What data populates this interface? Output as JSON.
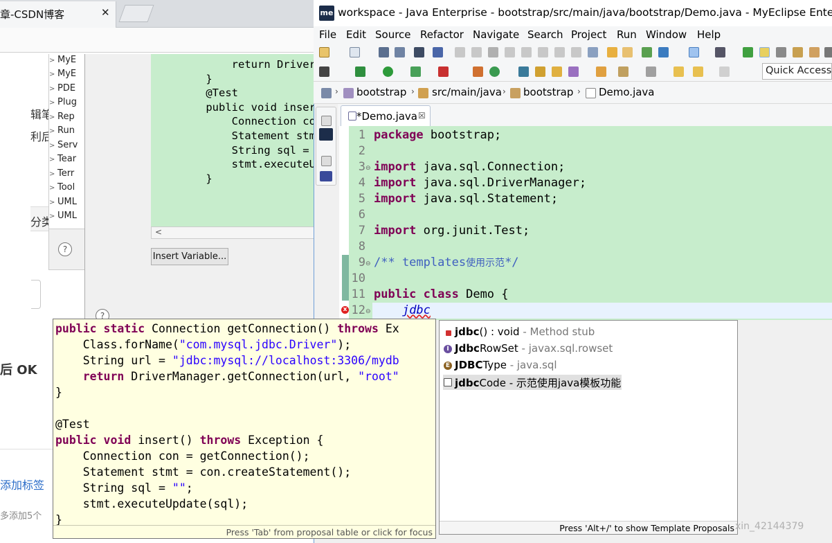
{
  "browser": {
    "tab_title": "章-CSDN博客",
    "tab_close": "✕",
    "side_fragments": [
      "辑笔",
      "利后",
      "分类",
      "后 OK",
      "添加标签",
      "多添加5个"
    ]
  },
  "preferences_dialog": {
    "tree_items": [
      "MyE",
      "MyE",
      "PDE",
      "Plug",
      "Rep",
      "Run",
      "Serv",
      "Tear",
      "Terr",
      "Tool",
      "UML",
      "UML"
    ],
    "help_symbol": "?",
    "editor_code": "        return DriverMana\n    }\n    @Test\n    public void insert()\n        Connection con =\n        Statement stmt =\n        String sql = \"\";\n        stmt.executeUpda\n    }",
    "scroll_left": "<",
    "insert_variable_button": "Insert Variable..."
  },
  "eclipse": {
    "logo": "me",
    "title": "workspace - Java Enterprise - bootstrap/src/main/java/bootstrap/Demo.java - MyEclipse Ente...",
    "menu": [
      "File",
      "Edit",
      "Source",
      "Refactor",
      "Navigate",
      "Search",
      "Project",
      "Run",
      "Window",
      "Help"
    ],
    "quick_access": "Quick Access",
    "breadcrumb": [
      "bootstrap",
      "src/main/java",
      "bootstrap",
      "Demo.java"
    ],
    "editor_tab": "*Demo.java",
    "editor_tab_close": "☒",
    "line_numbers": [
      "1",
      "2",
      "3",
      "4",
      "5",
      "6",
      "7",
      "8",
      "9",
      "10",
      "11",
      "12"
    ],
    "code": {
      "l1_kw": "package",
      "l1_rest": " bootstrap;",
      "l3_kw": "import",
      "l3_rest": " java.sql.Connection;",
      "l4_kw": "import",
      "l4_rest": " java.sql.DriverManager;",
      "l5_kw": "import",
      "l5_rest": " java.sql.Statement;",
      "l7_kw": "import",
      "l7_rest": " org.junit.Test;",
      "l9_doc": "/** templates",
      "l9_cjk": "使用示范",
      "l9_end": "*/",
      "l11_kw1": "public",
      "l11_kw2": "class",
      "l11_rest": " Demo {",
      "l12_typed": "jdbc"
    }
  },
  "template_preview": {
    "code_lines": [
      "public static Connection getConnection() throws Ex",
      "    Class.forName(\"com.mysql.jdbc.Driver\");",
      "    String url = \"jdbc:mysql://localhost:3306/mydb",
      "    return DriverManager.getConnection(url, \"root\"",
      "}",
      "",
      "@Test",
      "public void insert() throws Exception {",
      "    Connection con = getConnection();",
      "    Statement stmt = con.createStatement();",
      "    String sql = \"\";",
      "    stmt.executeUpdate(sql);",
      "}"
    ],
    "status": "Press 'Tab' from proposal table or click for focus"
  },
  "proposals": {
    "items": [
      {
        "bold": "jdbc",
        "rest": "() : void",
        "sub": " - Method stub",
        "icon": "method-icon",
        "color": "#d23030"
      },
      {
        "bold": "Jdbc",
        "rest": "RowSet",
        "sub": " - javax.sql.rowset",
        "icon": "interface-icon",
        "color": "#6a4fa0"
      },
      {
        "bold": "JDBC",
        "rest": "Type",
        "sub": " - java.sql",
        "icon": "enum-icon",
        "color": "#8a6020"
      },
      {
        "bold": "jdbc",
        "rest": "Code",
        "sub": " - 示范使用java模板功能",
        "icon": "template-icon",
        "color": "#555555"
      }
    ],
    "status": "Press 'Alt+/' to show Template Proposals",
    "watermark": "xin_42144379"
  },
  "colors": {
    "editor_bg": "#c7edcc",
    "keyword": "#7f0055",
    "javadoc": "#3f5fbf",
    "string": "#2a00ff",
    "tooltip_bg": "#ffffe1"
  }
}
